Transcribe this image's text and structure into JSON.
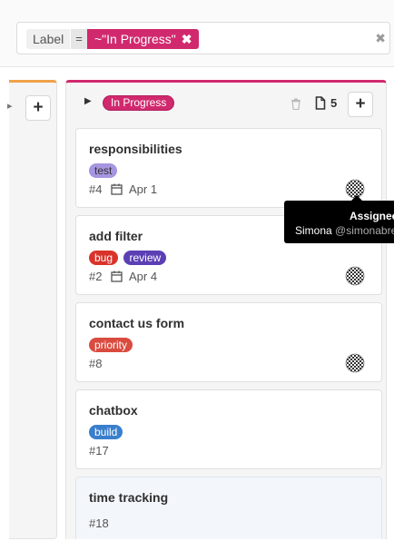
{
  "filter": {
    "token_label": "Label",
    "token_operator": "=",
    "token_value": "~\"In Progress\"",
    "token_remove": "✖",
    "clear": "✖"
  },
  "left_list": {
    "add": "+"
  },
  "list": {
    "title": "In Progress",
    "issue_count": "5",
    "add": "+",
    "color": "#d1296e"
  },
  "cards": [
    {
      "title": "responsibilities",
      "labels": [
        {
          "text": "test",
          "bg": "#a695e0",
          "fg": "#333333"
        }
      ],
      "number": "#4",
      "due": "Apr 1"
    },
    {
      "title": "add filter",
      "labels": [
        {
          "text": "bug",
          "bg": "#d9342b",
          "fg": "#ffffff"
        },
        {
          "text": "review",
          "bg": "#5b3fb4",
          "fg": "#ffffff"
        }
      ],
      "number": "#2",
      "due": "Apr 4"
    },
    {
      "title": "contact us form",
      "labels": [
        {
          "text": "priority",
          "bg": "#da4b3f",
          "fg": "#ffffff"
        }
      ],
      "number": "#8"
    },
    {
      "title": "chatbox",
      "labels": [
        {
          "text": "build",
          "bg": "#3a7fcc",
          "fg": "#ffffff"
        }
      ],
      "number": "#17"
    },
    {
      "title": "time tracking",
      "labels": [],
      "number": "#18"
    }
  ],
  "tooltip": {
    "title": "Assignee",
    "name": "Simona",
    "handle": "@simonabreje"
  }
}
